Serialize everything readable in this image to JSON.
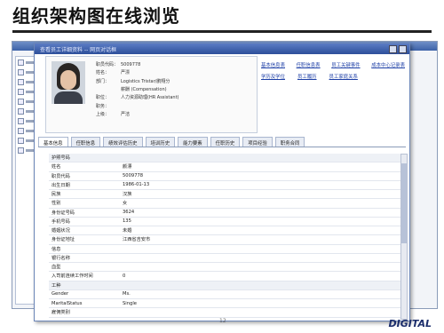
{
  "slide": {
    "title": "组织架构图在线浏览",
    "page_number": "12",
    "logo_text": "DIGITAL"
  },
  "window": {
    "title": "查看员工详细资料 -- 网页对话框"
  },
  "profile": {
    "fields": [
      {
        "label": "职员代码：",
        "value": "5009778"
      },
      {
        "label": "姓名：",
        "value": "严漂"
      },
      {
        "label": "部门：",
        "value": "Logistics Tristar/鹏翔分"
      },
      {
        "label": "",
        "value": "薪酬 (Compensation)"
      },
      {
        "label": "职位：",
        "value": "人力资源助理(HR Assistant)"
      },
      {
        "label": "职务：",
        "value": ""
      },
      {
        "label": "上级：",
        "value": "严洁"
      }
    ]
  },
  "links": [
    [
      "基本信息表",
      "任职信息表",
      "员工关键事件",
      "成本中心记录表"
    ],
    [
      "学历及学位",
      "员工履历",
      "员工家庭关系"
    ]
  ],
  "tabs": [
    "基本信息",
    "任职信息",
    "绩效评估历史",
    "培训历史",
    "能力要素",
    "任职历史",
    "项目经验",
    "职务合同"
  ],
  "table": {
    "rows": [
      {
        "label": "护照号码",
        "value": "",
        "section": true
      },
      {
        "label": "姓名",
        "value": "颜漂"
      },
      {
        "label": "职员代码",
        "value": "5009778"
      },
      {
        "label": "出生日期",
        "value": "1986-01-13"
      },
      {
        "label": "民族",
        "value": "汉族"
      },
      {
        "label": "性别",
        "value": "女"
      },
      {
        "label": "身份证号码",
        "value": "3624"
      },
      {
        "label": "手机号码",
        "value": "135"
      },
      {
        "label": "婚姻状况",
        "value": "未婚"
      },
      {
        "label": "身份证地址",
        "value": "江西省吉安市"
      },
      {
        "label": "信息",
        "value": ""
      },
      {
        "label": "银行名称",
        "value": ""
      },
      {
        "label": "血型",
        "value": ""
      },
      {
        "label": "入司前连续工作时间",
        "value": "0"
      },
      {
        "label": "工种",
        "value": "",
        "section": true
      },
      {
        "label": "Gender",
        "value": "Ms."
      },
      {
        "label": "MaritalStatus",
        "value": "Single"
      },
      {
        "label": "雇佣类别",
        "value": ""
      }
    ]
  },
  "colors": {
    "title_bar": "#3c62a8",
    "link": "#1d3fa6"
  }
}
